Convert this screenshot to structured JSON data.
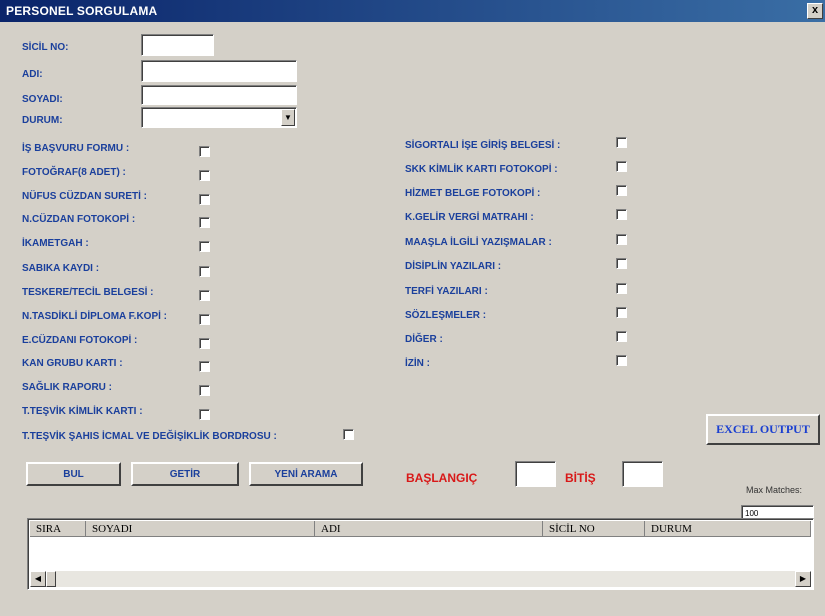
{
  "window": {
    "title": "PERSONEL SORGULAMA",
    "close_glyph": "x"
  },
  "fields": {
    "sicil_label": "SİCİL NO:",
    "adi_label": "ADI:",
    "soyadi_label": "SOYADI:",
    "durum_label": "DURUM:",
    "sicil_value": "",
    "adi_value": "",
    "soyadi_value": "",
    "durum_value": ""
  },
  "left_checks": [
    "İŞ BAŞVURU FORMU :",
    "FOTOĞRAF(8 ADET) :",
    "NÜFUS CÜZDAN SURETİ :",
    "N.CÜZDAN FOTOKOPİ :",
    "İKAMETGAH :",
    "SABIKA KAYDI :",
    "TESKERE/TECİL BELGESİ :",
    "N.TASDİKLİ DİPLOMA F.KOPİ :",
    "E.CÜZDANI FOTOKOPİ :",
    "KAN GRUBU KARTI :",
    "SAĞLIK RAPORU :",
    "T.TEŞVİK KİMLİK KARTI :",
    "T.TEŞVİK ŞAHIS İCMAL VE DEĞİŞİKLİK BORDROSU :"
  ],
  "right_checks": [
    "SİGORTALI İŞE GİRİŞ BELGESİ :",
    "SKK KİMLİK KARTI FOTOKOPİ :",
    "HİZMET BELGE FOTOKOPİ :",
    "K.GELİR VERGİ MATRAHI :",
    "MAAŞLA İLGİLİ YAZIŞMALAR :",
    "DİSİPLİN YAZILARI :",
    "TERFİ YAZILARI :",
    "SÖZLEŞMELER :",
    "DİĞER :",
    "İZİN :"
  ],
  "buttons": {
    "bul": "BUL",
    "getir": "GETİR",
    "yeni_arama": "YENİ ARAMA",
    "excel": "EXCEL OUTPUT"
  },
  "range": {
    "baslangic_label": "BAŞLANGIÇ",
    "bitis_label": "BİTİŞ",
    "baslangic_value": "",
    "bitis_value": ""
  },
  "max_matches": {
    "label": "Max Matches:",
    "value": "100"
  },
  "grid": {
    "columns": [
      "SIRA",
      "SOYADI",
      "ADI",
      "SİCİL NO",
      "DURUM"
    ]
  },
  "icons": {
    "combo": "chevron-down-icon",
    "scroll_left": "arrow-left-icon",
    "scroll_right": "arrow-right-icon"
  }
}
